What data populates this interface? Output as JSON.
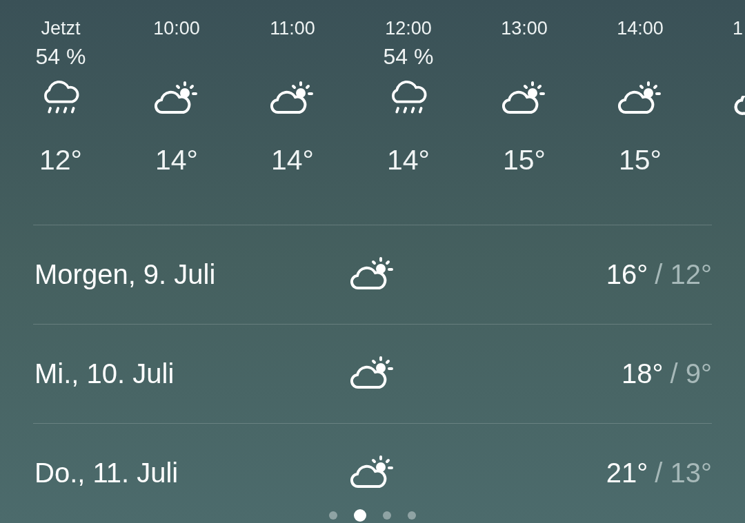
{
  "hourly": [
    {
      "time": "Jetzt",
      "precipitation": "54 %",
      "kind": "rain",
      "temp": "12°"
    },
    {
      "time": "10:00",
      "kind": "partly",
      "temp": "14°"
    },
    {
      "time": "11:00",
      "kind": "partly",
      "temp": "14°"
    },
    {
      "time": "12:00",
      "precipitation": "54 %",
      "kind": "rain",
      "temp": "14°"
    },
    {
      "time": "13:00",
      "kind": "partly",
      "temp": "15°"
    },
    {
      "time": "14:00",
      "kind": "partly",
      "temp": "15°"
    },
    {
      "time": "1",
      "kind": "partly"
    }
  ],
  "daily": [
    {
      "day": "Morgen, 9. Juli",
      "kind": "partly",
      "high": "16°",
      "low": "/ 12°"
    },
    {
      "day": "Mi., 10. Juli",
      "kind": "partly",
      "high": "18°",
      "low": "/ 9°"
    },
    {
      "day": "Do., 11. Juli",
      "kind": "partly",
      "high": "21°",
      "low": "/ 13°"
    }
  ],
  "pages": [
    {
      "selected": false
    },
    {
      "selected": true
    },
    {
      "selected": false
    },
    {
      "selected": false
    }
  ]
}
